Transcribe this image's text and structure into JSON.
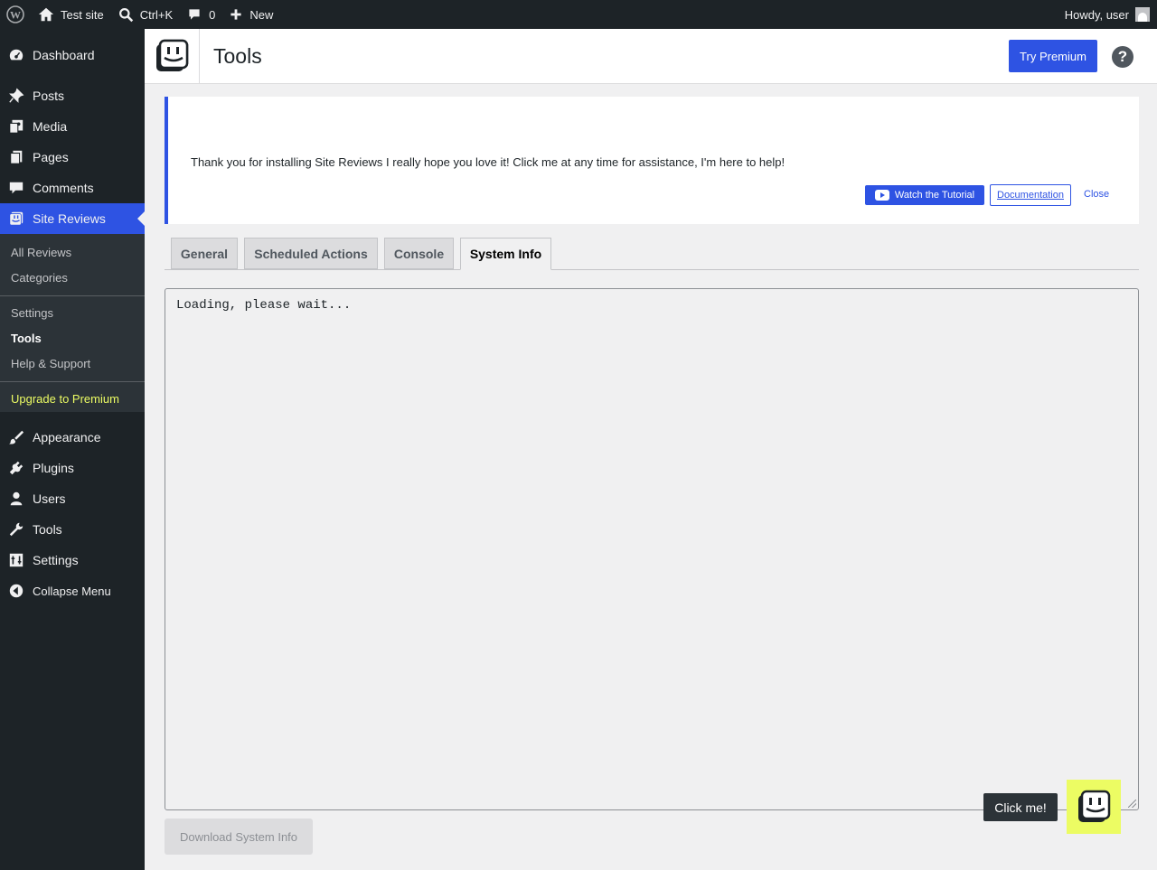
{
  "adminbar": {
    "site_name": "Test site",
    "search_shortcut": "Ctrl+K",
    "comments_count": "0",
    "new_label": "New",
    "howdy": "Howdy, user"
  },
  "sidebar": {
    "items": [
      {
        "label": "Dashboard",
        "icon": "dashboard-icon"
      },
      {
        "label": "Posts",
        "icon": "pin-icon"
      },
      {
        "label": "Media",
        "icon": "media-icon"
      },
      {
        "label": "Pages",
        "icon": "pages-icon"
      },
      {
        "label": "Comments",
        "icon": "comments-icon"
      },
      {
        "label": "Site Reviews",
        "icon": "site-reviews-icon"
      }
    ],
    "submenu": {
      "all_reviews": "All Reviews",
      "categories": "Categories",
      "settings": "Settings",
      "tools": "Tools",
      "help_support": "Help & Support",
      "upgrade": "Upgrade to Premium"
    },
    "items_after": [
      {
        "label": "Appearance",
        "icon": "appearance-icon"
      },
      {
        "label": "Plugins",
        "icon": "plugins-icon"
      },
      {
        "label": "Users",
        "icon": "users-icon"
      },
      {
        "label": "Tools",
        "icon": "tools-icon"
      },
      {
        "label": "Settings",
        "icon": "settings-icon"
      }
    ],
    "collapse_label": "Collapse Menu"
  },
  "header": {
    "title": "Tools",
    "try_premium": "Try Premium",
    "help_label": "?"
  },
  "notice": {
    "message": "Thank you for installing Site Reviews I really hope you love it! Click me at any time for assistance, I'm here to help!",
    "watch_tutorial": "Watch the Tutorial",
    "documentation": "Documentation",
    "close": "Close"
  },
  "tabs": [
    {
      "label": "General"
    },
    {
      "label": "Scheduled Actions"
    },
    {
      "label": "Console"
    },
    {
      "label": "System Info"
    }
  ],
  "system_info": {
    "content": "Loading, please wait...",
    "download_label": "Download System Info"
  },
  "assistant": {
    "tooltip": "Click me!"
  },
  "colors": {
    "accent": "#2e53e3",
    "admin_dark": "#1d2327",
    "assistant_bg": "#ecfc63"
  }
}
